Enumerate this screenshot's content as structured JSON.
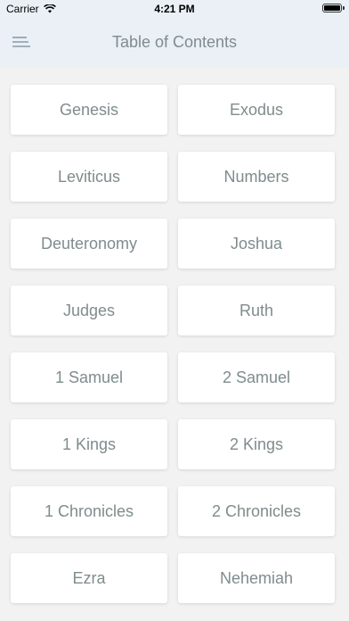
{
  "status_bar": {
    "carrier": "Carrier",
    "time": "4:21 PM"
  },
  "header": {
    "title": "Table of Contents",
    "menu_icon": "hamburger-menu-icon"
  },
  "books": [
    {
      "label": "Genesis"
    },
    {
      "label": "Exodus"
    },
    {
      "label": "Leviticus"
    },
    {
      "label": "Numbers"
    },
    {
      "label": "Deuteronomy"
    },
    {
      "label": "Joshua"
    },
    {
      "label": "Judges"
    },
    {
      "label": "Ruth"
    },
    {
      "label": "1 Samuel"
    },
    {
      "label": "2 Samuel"
    },
    {
      "label": "1 Kings"
    },
    {
      "label": "2 Kings"
    },
    {
      "label": "1 Chronicles"
    },
    {
      "label": "2 Chronicles"
    },
    {
      "label": "Ezra"
    },
    {
      "label": "Nehemiah"
    }
  ],
  "colors": {
    "header_bg": "#eaf0f6",
    "page_bg": "#f2f2f2",
    "text": "#7f8c8d",
    "button_bg": "#ffffff"
  }
}
